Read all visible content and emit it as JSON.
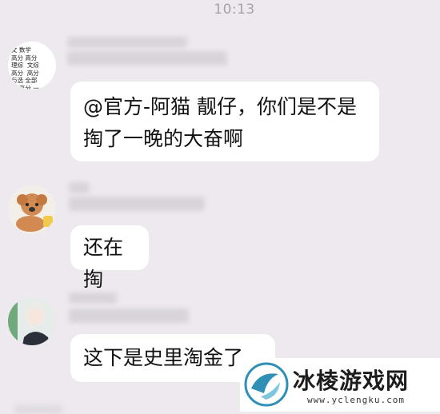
{
  "status_bar": {
    "time": "10:13"
  },
  "messages": [
    {
      "avatar_text": "文 数学\n高分 高分\n理综  文综\n高分  高分\n与选 全部\n分 高分 一",
      "text": "@官方-阿猫 靓仔，你们是不是掏了一晚的大奋啊"
    },
    {
      "text": "还在掏"
    },
    {
      "text": "这下是史里淘金了"
    }
  ],
  "watermark": {
    "title": "冰棱游戏网",
    "url": "www.yclengku.com"
  },
  "colors": {
    "background": "#ede9ee",
    "bubble": "#ffffff",
    "accent": "#2f8fb5"
  },
  "icons": [
    "dog-avatar-icon",
    "girl-avatar-icon",
    "ice-crystal-logo-icon"
  ]
}
